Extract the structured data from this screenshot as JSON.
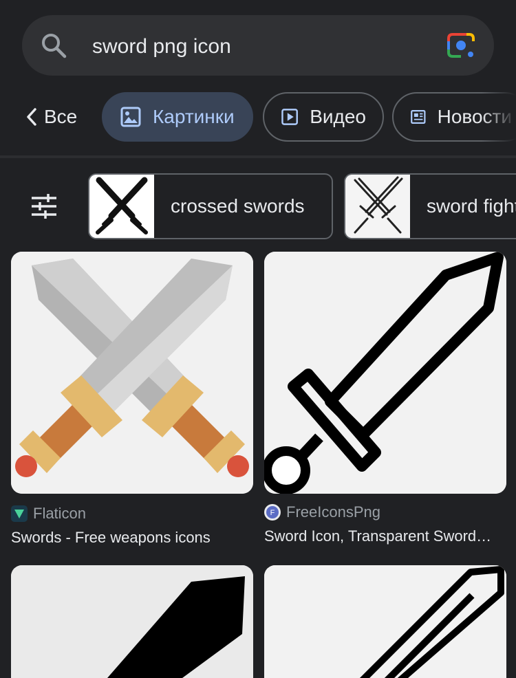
{
  "search": {
    "query": "sword png icon"
  },
  "tabs": {
    "back_label": "Все",
    "items": [
      {
        "label": "Картинки",
        "active": true
      },
      {
        "label": "Видео",
        "active": false
      },
      {
        "label": "Новости",
        "active": false
      }
    ]
  },
  "suggestions": [
    {
      "label": "crossed swords"
    },
    {
      "label": "sword fight"
    }
  ],
  "results": [
    {
      "source": "Flaticon",
      "title": "Swords - Free weapons icons"
    },
    {
      "source": "FreeIconsPng",
      "title": "Sword Icon, Transparent Sword Png"
    }
  ],
  "colors": {
    "background": "#202124",
    "search_bg": "#303134",
    "active_chip_bg": "#394457",
    "active_chip_text": "#aecbfa"
  },
  "icons": [
    "search-icon",
    "google-lens-icon",
    "chevron-left-icon",
    "image-icon",
    "play-icon",
    "news-icon",
    "filter-sliders-icon"
  ]
}
